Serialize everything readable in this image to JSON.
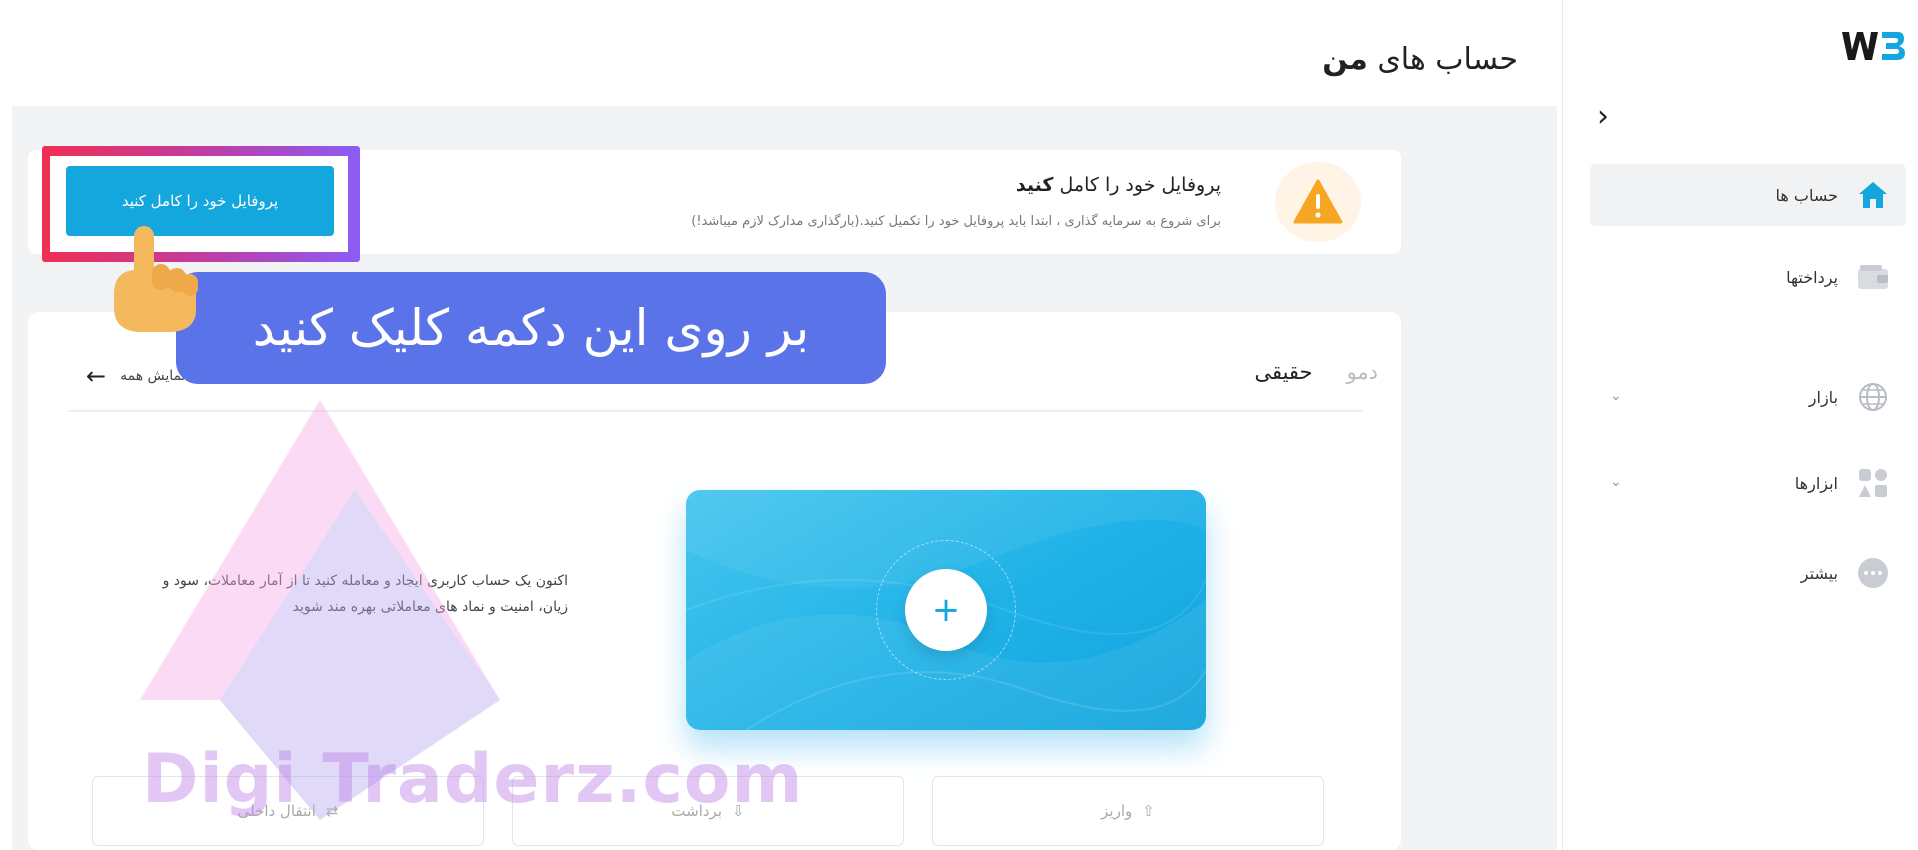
{
  "sidebar": {
    "logo_text": "W3",
    "items": [
      {
        "label": "حساب ها",
        "icon": "home-icon"
      },
      {
        "label": "پرداختها",
        "icon": "wallet-icon"
      },
      {
        "label": "بازار",
        "icon": "globe-icon"
      },
      {
        "label": "ابزارها",
        "icon": "tools-icon"
      },
      {
        "label": "بیشتر",
        "icon": "more-icon"
      }
    ]
  },
  "header": {
    "title_part1": "حساب های",
    "title_part2": "من"
  },
  "alert": {
    "title_part1": "پروفایل خود را کامل",
    "title_part2": "کنید",
    "subtitle": "برای شروع به سرمایه گذاری ، ابتدا باید پروفایل خود را تکمیل کنید.(بارگذاری مدارک لازم میباشد!)",
    "button_label": "پروفایل خود را کامل کنید"
  },
  "tabs": {
    "items": [
      "حقیقی",
      "دمو"
    ],
    "active": "حقیقی",
    "view_all_label": "نمایش همه"
  },
  "promo": {
    "text": "اکنون یک حساب کاربری ایجاد و معامله کنید تا از آمار معاملات، سود و زیان، امنیت و نماد های معاملاتی بهره مند شوید"
  },
  "actions": {
    "deposit": "واریز",
    "withdraw": "برداشت",
    "transfer": "انتقال داخلی"
  },
  "watermark": {
    "text": "Digi   Traderz.com"
  },
  "tutorial": {
    "tooltip_text": "بر روی این دکمه کلیک کنید"
  },
  "colors": {
    "accent": "#14a7de",
    "tooltip": "#5a73e8",
    "warning": "#f6a623",
    "highlight_start": "#ef2f52",
    "highlight_end": "#8b5cf6"
  }
}
